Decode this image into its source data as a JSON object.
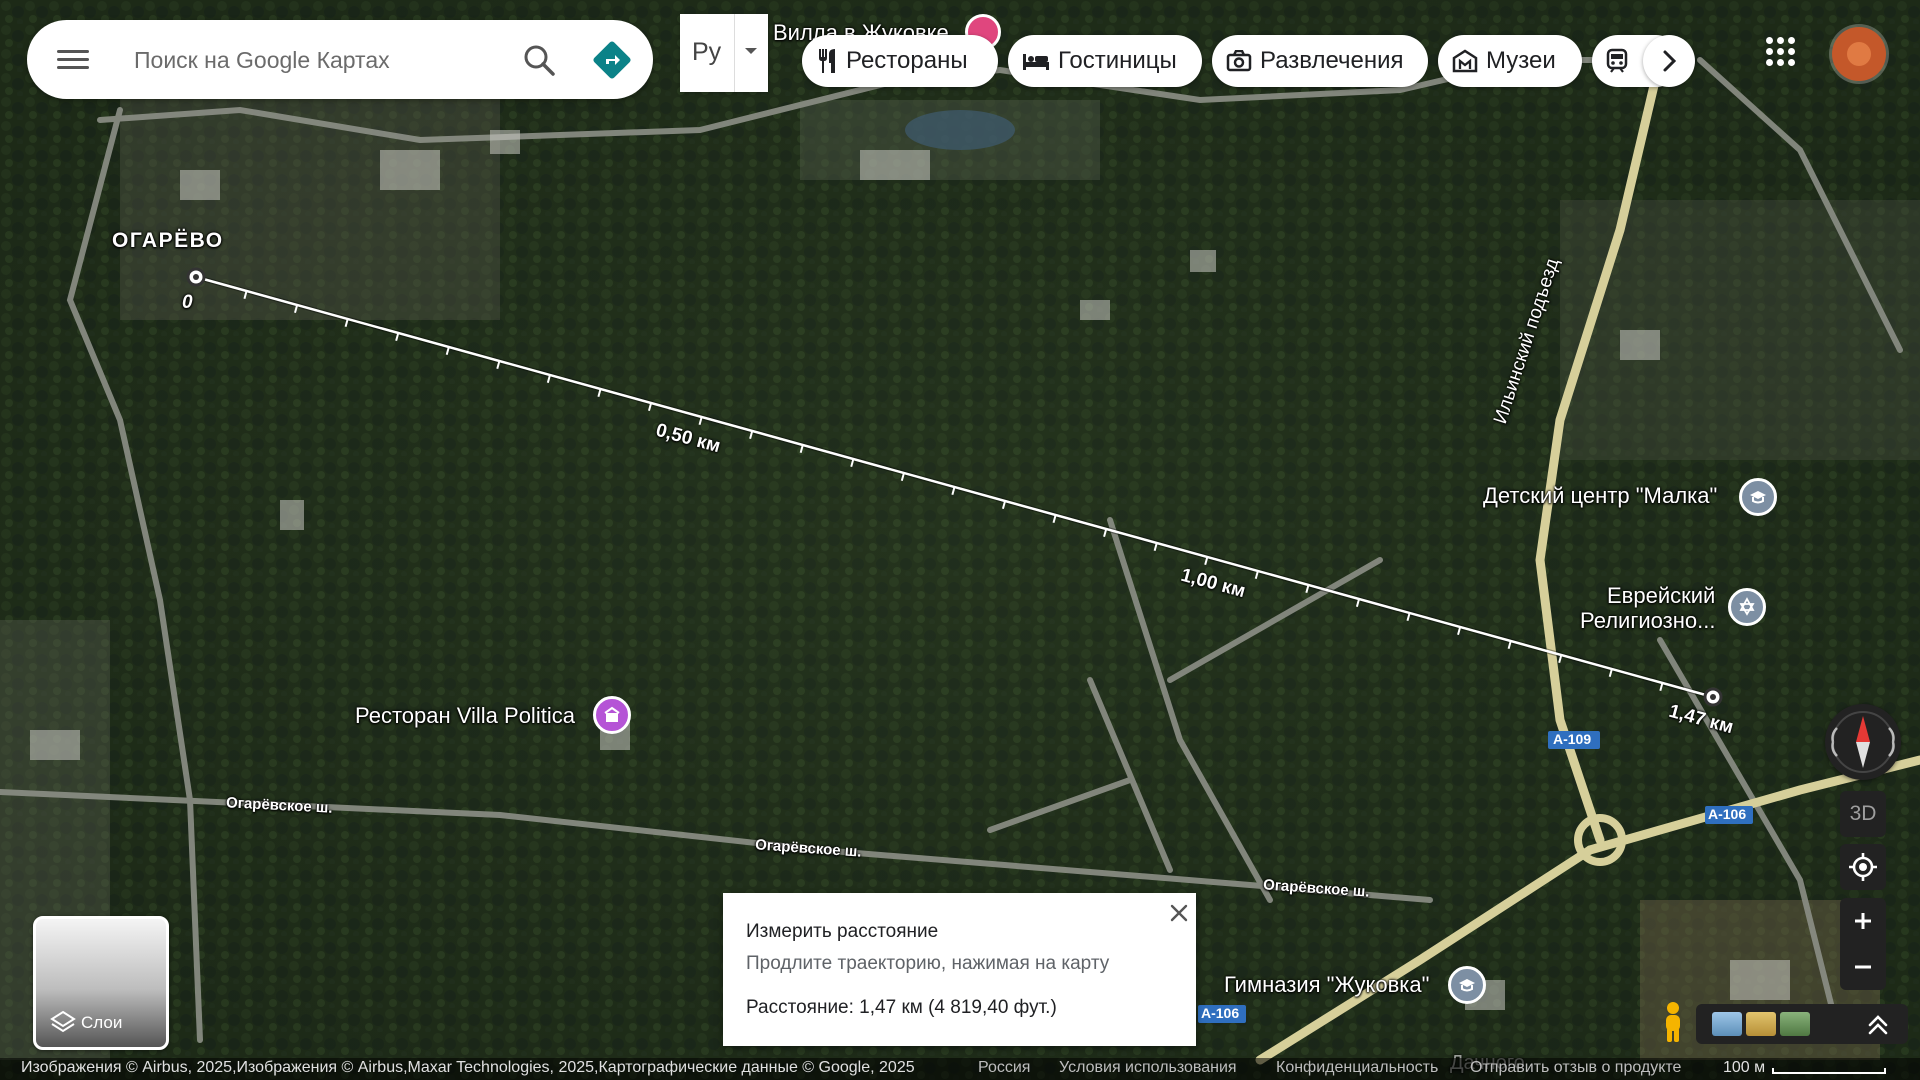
{
  "search": {
    "placeholder": "Поиск на Google Картах"
  },
  "language": {
    "label": "Ру"
  },
  "chips": [
    {
      "label": "Рестораны",
      "icon": "fork-knife-icon"
    },
    {
      "label": "Гостиницы",
      "icon": "bed-icon"
    },
    {
      "label": "Развлечения",
      "icon": "camera-icon"
    },
    {
      "label": "Музеи",
      "icon": "museum-icon"
    },
    {
      "label": "",
      "icon": "train-icon"
    }
  ],
  "map_labels": {
    "village": "ОГАРЁВО",
    "villa_partial": "Вилла в Жуковке",
    "malka": "Детский центр \"Малка\"",
    "jewish_line1": "Еврейский",
    "jewish_line2": "Религиозно...",
    "restaurant": "Ресторан Villa Politica",
    "gymnasium": "Гимназия \"Жуковка\"",
    "road_vertical": "Ильинский подъезд",
    "road_ogarevskoe": "Огарёвское ш.",
    "road_a109": "А-109",
    "road_a106": "А-106",
    "road_danshnogo": "Дачного"
  },
  "measure_line": {
    "start_label": "0",
    "mid1_label": "0,50 км",
    "mid2_label": "1,00 км",
    "end_label": "1,47 км"
  },
  "measure_panel": {
    "title": "Измерить расстояние",
    "hint": "Продлите траекторию, нажимая на карту",
    "distance": "Расстояние: 1,47 км (4 819,40 фут.)"
  },
  "layers": {
    "label": "Слои"
  },
  "controls": {
    "btn3d": "3D"
  },
  "footer": {
    "attribution": "Изображения © Airbus, 2025,Изображения © Airbus,Maxar Technologies, 2025,Картографические данные © Google, 2025",
    "country": "Россия",
    "terms": "Условия использования",
    "privacy": "Конфиденциальность",
    "feedback": "Отправить отзыв о продукте",
    "scale": "100 м"
  },
  "colors": {
    "accent_teal": "#188038",
    "restaurant_pin": "#b554d6",
    "edu_pin": "#7d8fa3",
    "ruler_line": "#ffffff"
  }
}
